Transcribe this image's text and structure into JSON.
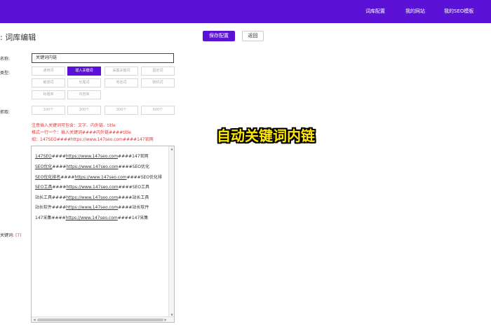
{
  "topbar": {
    "color": "#5b12d6",
    "nav": [
      "词库配置",
      "我的网站",
      "我的SEO模板"
    ]
  },
  "page_title": ": 词库编辑",
  "buttons": {
    "save": "保存配置",
    "back": "返回"
  },
  "form": {
    "name_label": "名称:",
    "name_value": "关键词内链",
    "type_label": "类型:",
    "types": [
      "通用词",
      "插入关键词",
      "采集关键词",
      "固定词",
      "敏感词",
      "长尾词",
      "地名词",
      "随机词",
      "标题库",
      "内容库"
    ],
    "active_type": "插入关键词",
    "count_label": "抓取:",
    "counts": [
      "100个",
      "200个",
      "300个",
      "500个"
    ],
    "keywords_label": "关键词:",
    "keywords_count": "(7)"
  },
  "notes": [
    "注意插入关键词可包含：文字、内外链、title",
    "格式一行一个：插入关键词####内外链####title",
    "如：147SEO####https://www.147seo.com####147官网"
  ],
  "editor_lines": [
    {
      "kw": "147SEO",
      "url": "https://www.147seo.com",
      "title": "147官网"
    },
    {
      "kw": "SEO优化",
      "url": "https://www.147seo.com",
      "title": "SEO优化"
    },
    {
      "kw": "SEO优化排名",
      "url": "https://www.147seo.com",
      "title": "SEO优化排"
    },
    {
      "kw": "SEO工具",
      "url": "https://www.147seo.com",
      "title": "SEO工具"
    },
    {
      "kw": "站长工具",
      "url": "https://www.147seo.com",
      "title": "站长工具"
    },
    {
      "kw": "站长软件",
      "url": "https://www.147seo.com",
      "title": "站长软件"
    },
    {
      "kw": "147采集",
      "url": "https://www.147seo.com",
      "title": "147采集"
    }
  ],
  "overlay_caption": "自动关键词内链"
}
